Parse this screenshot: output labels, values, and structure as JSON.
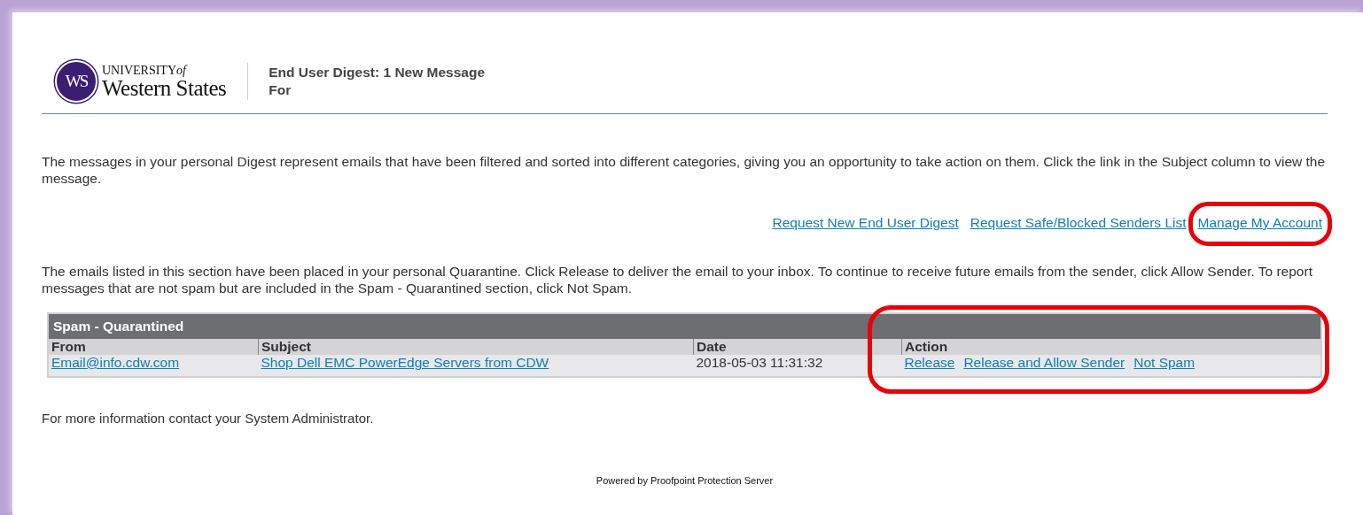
{
  "logo": {
    "monogram": "WS",
    "line1": "UNIVERSITY",
    "line1_suffix": "of",
    "line2": "Western States"
  },
  "header": {
    "title": "End User Digest: 1 New Message",
    "subtitle": "For"
  },
  "intro": "The messages in your personal Digest represent emails that have been filtered and sorted into different categories, giving you an opportunity to take action on them. Click the link in the Subject column to view the message.",
  "links": [
    {
      "label": "Request New End User Digest",
      "highlighted": false
    },
    {
      "label": "Request Safe/Blocked Senders List",
      "highlighted": false
    },
    {
      "label": "Manage My Account",
      "highlighted": true
    }
  ],
  "quarantine_note": "The emails listed in this section have been placed in your personal Quarantine. Click Release to deliver the email to your inbox. To continue to receive future emails from the sender, click Allow Sender. To report messages that are not spam but are included in the Spam - Quarantined section, click Not Spam.",
  "table": {
    "title": "Spam - Quarantined",
    "actions_highlighted": true,
    "columns": [
      "From",
      "Subject",
      "Date",
      "Action"
    ],
    "rows": [
      {
        "from": "Email@info.cdw.com",
        "subject": "Shop Dell EMC PowerEdge Servers from CDW",
        "date": "2018-05-03 11:31:32",
        "actions": [
          "Release",
          "Release and Allow Sender",
          "Not Spam"
        ]
      }
    ]
  },
  "contact_note": "For more information contact your System Administrator.",
  "footer": "Powered by Proofpoint Protection Server"
}
